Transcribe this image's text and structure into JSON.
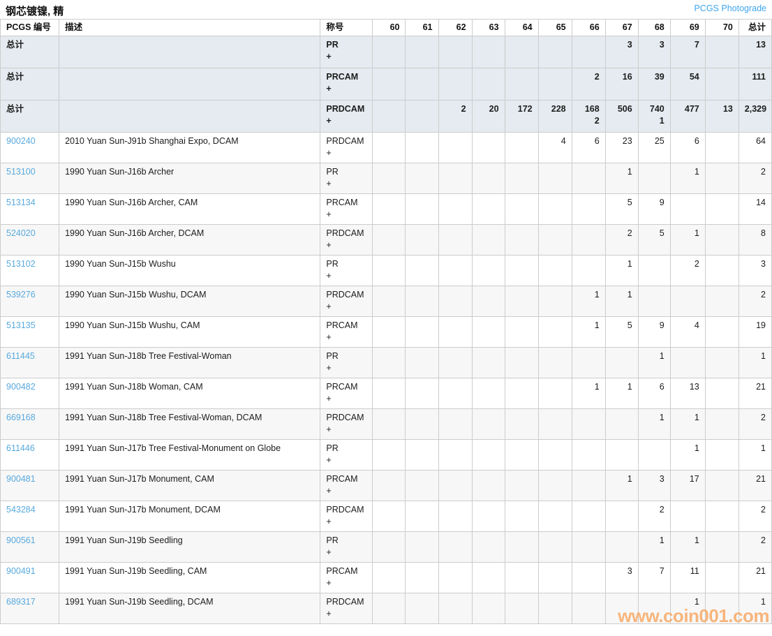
{
  "page": {
    "title": "钢芯镀镍, 精",
    "photograde_link": "PCGS Photograde"
  },
  "watermark": "www.coin001.com",
  "colors": {
    "link": "#58a9dd",
    "photograde": "#3fa5ef",
    "total_bg": "#e5ebf0",
    "stripe": "#f7f7f7",
    "border": "#cccccc",
    "watermark": "#f7a55e",
    "text": "#1c1c1c"
  },
  "table": {
    "columns": [
      "PCGS 编号",
      "描述",
      "称号",
      "60",
      "61",
      "62",
      "63",
      "64",
      "65",
      "66",
      "67",
      "68",
      "69",
      "70",
      "总计"
    ],
    "grade_keys": [
      "60",
      "61",
      "62",
      "63",
      "64",
      "65",
      "66",
      "67",
      "68",
      "69",
      "70",
      "total"
    ],
    "total_rows": [
      {
        "label": "总计",
        "desc": "",
        "designation": "PR",
        "plus": "+",
        "line1": {
          "67": "3",
          "68": "3",
          "69": "7",
          "total": "13"
        },
        "line2": {}
      },
      {
        "label": "总计",
        "desc": "",
        "designation": "PRCAM",
        "plus": "+",
        "line1": {
          "66": "2",
          "67": "16",
          "68": "39",
          "69": "54",
          "total": "111"
        },
        "line2": {}
      },
      {
        "label": "总计",
        "desc": "",
        "designation": "PRDCAM",
        "plus": "+",
        "line1": {
          "62": "2",
          "63": "20",
          "64": "172",
          "65": "228",
          "66": "168",
          "67": "506",
          "68": "740",
          "69": "477",
          "70": "13",
          "total": "2,329"
        },
        "line2": {
          "66": "2",
          "68": "1"
        }
      }
    ],
    "rows": [
      {
        "pcgs_no": "900240",
        "desc": "2010 Yuan Sun-J91b Shanghai Expo, DCAM",
        "designation": "PRDCAM",
        "plus": "+",
        "line1": {
          "65": "4",
          "66": "6",
          "67": "23",
          "68": "25",
          "69": "6",
          "total": "64"
        }
      },
      {
        "pcgs_no": "513100",
        "desc": "1990 Yuan Sun-J16b Archer",
        "designation": "PR",
        "plus": "+",
        "line1": {
          "67": "1",
          "69": "1",
          "total": "2"
        }
      },
      {
        "pcgs_no": "513134",
        "desc": "1990 Yuan Sun-J16b Archer, CAM",
        "designation": "PRCAM",
        "plus": "+",
        "line1": {
          "67": "5",
          "68": "9",
          "total": "14"
        }
      },
      {
        "pcgs_no": "524020",
        "desc": "1990 Yuan Sun-J16b Archer, DCAM",
        "designation": "PRDCAM",
        "plus": "+",
        "line1": {
          "67": "2",
          "68": "5",
          "69": "1",
          "total": "8"
        }
      },
      {
        "pcgs_no": "513102",
        "desc": "1990 Yuan Sun-J15b Wushu",
        "designation": "PR",
        "plus": "+",
        "line1": {
          "67": "1",
          "69": "2",
          "total": "3"
        }
      },
      {
        "pcgs_no": "539276",
        "desc": "1990 Yuan Sun-J15b Wushu, DCAM",
        "designation": "PRDCAM",
        "plus": "+",
        "line1": {
          "66": "1",
          "67": "1",
          "total": "2"
        }
      },
      {
        "pcgs_no": "513135",
        "desc": "1990 Yuan Sun-J15b Wushu, CAM",
        "designation": "PRCAM",
        "plus": "+",
        "line1": {
          "66": "1",
          "67": "5",
          "68": "9",
          "69": "4",
          "total": "19"
        }
      },
      {
        "pcgs_no": "611445",
        "desc": "1991 Yuan Sun-J18b Tree Festival-Woman",
        "designation": "PR",
        "plus": "+",
        "line1": {
          "68": "1",
          "total": "1"
        }
      },
      {
        "pcgs_no": "900482",
        "desc": "1991 Yuan Sun-J18b Woman, CAM",
        "designation": "PRCAM",
        "plus": "+",
        "line1": {
          "66": "1",
          "67": "1",
          "68": "6",
          "69": "13",
          "total": "21"
        }
      },
      {
        "pcgs_no": "669168",
        "desc": "1991 Yuan Sun-J18b Tree Festival-Woman, DCAM",
        "designation": "PRDCAM",
        "plus": "+",
        "line1": {
          "68": "1",
          "69": "1",
          "total": "2"
        }
      },
      {
        "pcgs_no": "611446",
        "desc": "1991 Yuan Sun-J17b Tree Festival-Monument on Globe",
        "designation": "PR",
        "plus": "+",
        "line1": {
          "69": "1",
          "total": "1"
        }
      },
      {
        "pcgs_no": "900481",
        "desc": "1991 Yuan Sun-J17b Monument, CAM",
        "designation": "PRCAM",
        "plus": "+",
        "line1": {
          "67": "1",
          "68": "3",
          "69": "17",
          "total": "21"
        }
      },
      {
        "pcgs_no": "543284",
        "desc": "1991 Yuan Sun-J17b Monument, DCAM",
        "designation": "PRDCAM",
        "plus": "+",
        "line1": {
          "68": "2",
          "total": "2"
        }
      },
      {
        "pcgs_no": "900561",
        "desc": "1991 Yuan Sun-J19b Seedling",
        "designation": "PR",
        "plus": "+",
        "line1": {
          "68": "1",
          "69": "1",
          "total": "2"
        }
      },
      {
        "pcgs_no": "900491",
        "desc": "1991 Yuan Sun-J19b Seedling, CAM",
        "designation": "PRCAM",
        "plus": "+",
        "line1": {
          "67": "3",
          "68": "7",
          "69": "11",
          "total": "21"
        }
      },
      {
        "pcgs_no": "689317",
        "desc": "1991 Yuan Sun-J19b Seedling, DCAM",
        "designation": "PRDCAM",
        "plus": "+",
        "line1": {
          "69": "1",
          "total": "1"
        }
      }
    ]
  }
}
